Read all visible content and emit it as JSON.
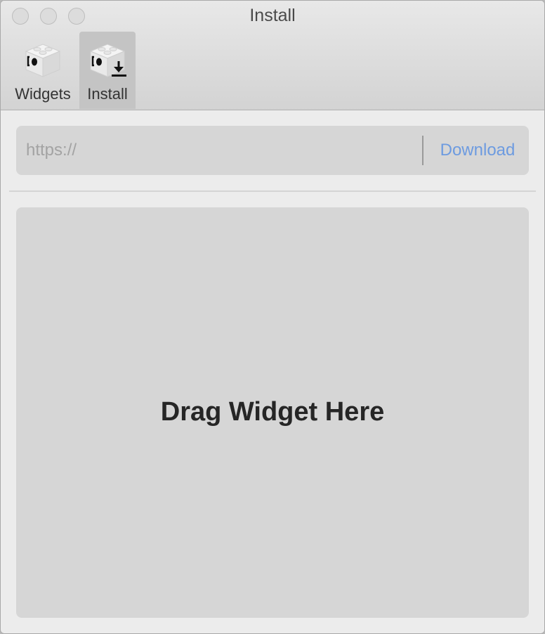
{
  "window": {
    "title": "Install"
  },
  "toolbar": {
    "items": [
      {
        "label": "Widgets",
        "icon": "widgets-icon",
        "selected": false
      },
      {
        "label": "Install",
        "icon": "install-icon",
        "selected": true
      }
    ]
  },
  "url_bar": {
    "value": "",
    "placeholder": "https://",
    "download_label": "Download"
  },
  "drop_zone": {
    "label": "Drag Widget Here"
  },
  "colors": {
    "accent": "#6d9be0",
    "selected_tab": "#c4c4c4",
    "panel": "#d6d6d6"
  }
}
